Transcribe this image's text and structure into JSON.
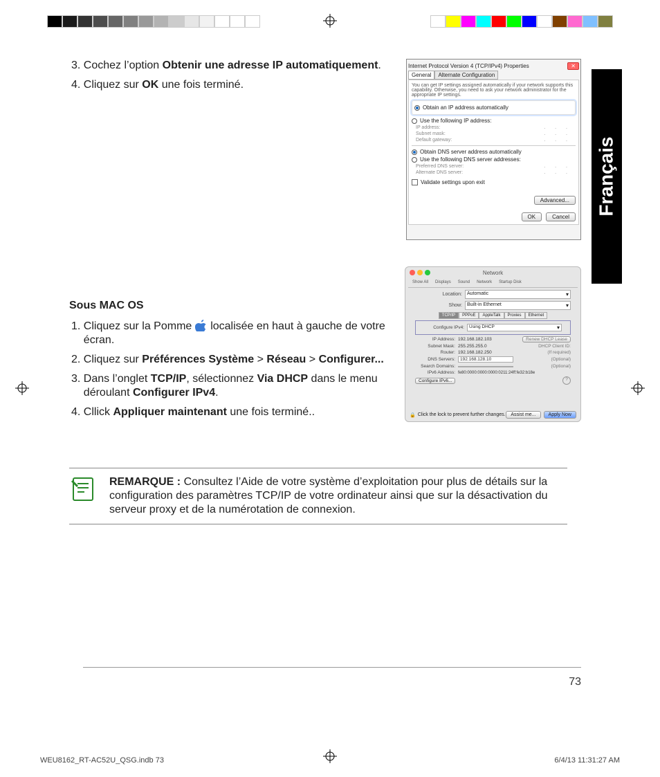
{
  "print": {
    "docname": "WEU8162_RT-AC52U_QSG.indb   73",
    "datetime": "6/4/13   11:31:27 AM",
    "colorbar_left": [
      "#000000",
      "#1a1a1a",
      "#333333",
      "#4d4d4d",
      "#666666",
      "#808080",
      "#999999",
      "#b3b3b3",
      "#cccccc",
      "#e6e6e6",
      "#f2f2f2",
      "#ffffff",
      "#ffffff",
      "#ffffff"
    ],
    "colorbar_right": [
      "#ffffff",
      "#ffff00",
      "#ff00ff",
      "#00ffff",
      "#ff0000",
      "#00ff00",
      "#0000ff",
      "#ffffff",
      "#804000",
      "#ff69d0",
      "#80c0ff",
      "#808040"
    ]
  },
  "lang_tab": "Français",
  "steps_a": [
    {
      "n": "3.",
      "pre": "Cochez l’option ",
      "bold": "Obtenir une adresse IP automatiquement",
      "post": "."
    },
    {
      "n": "4.",
      "pre": "Cliquez sur ",
      "bold": "OK",
      "post": " une fois terminé."
    }
  ],
  "macos_heading": "Sous MAC OS",
  "steps_b": [
    {
      "n": "1.",
      "parts": [
        "Cliquez sur la Pomme ",
        "ICON",
        " localisée en haut à gauche de votre écran."
      ]
    },
    {
      "n": "2.",
      "parts": [
        "Cliquez sur ",
        "B:Préférences Système",
        " > ",
        "B:Réseau",
        " > ",
        "B:Configurer..."
      ]
    },
    {
      "n": "3.",
      "parts": [
        "Dans l’onglet ",
        "B:TCP/IP",
        ", sélectionnez ",
        "B:Via DHCP",
        " dans le menu déroulant ",
        "B:Configurer IPv4",
        "."
      ]
    },
    {
      "n": "4.",
      "parts": [
        "Cllick ",
        "B:Appliquer maintenant",
        " une fois terminé.."
      ]
    }
  ],
  "note": {
    "label": "REMARQUE : ",
    "text": "Consultez l’Aide de votre système d’exploitation pour plus de détails sur la configuration des paramètres TCP/IP de votre ordinateur ainsi que sur la désactivation du serveur proxy et de la numérotation de connexion."
  },
  "page_number": "73",
  "win_dialog": {
    "title": "Internet Protocol Version 4 (TCP/IPv4) Properties",
    "tabs": [
      "General",
      "Alternate Configuration"
    ],
    "hint": "You can get IP settings assigned automatically if your network supports this capability. Otherwise, you need to ask your network administrator for the appropriate IP settings.",
    "r1": "Obtain an IP address automatically",
    "r2": "Use the following IP address:",
    "f_ip": "IP address:",
    "f_sm": "Subnet mask:",
    "f_gw": "Default gateway:",
    "r3": "Obtain DNS server address automatically",
    "r4": "Use the following DNS server addresses:",
    "f_pd": "Preferred DNS server:",
    "f_ad": "Alternate DNS server:",
    "chk": "Validate settings upon exit",
    "adv": "Advanced...",
    "ok": "OK",
    "cancel": "Cancel"
  },
  "mac_dialog": {
    "title": "Network",
    "toolbar": [
      "Show All",
      "Displays",
      "Sound",
      "Network",
      "Startup Disk"
    ],
    "location_lbl": "Location:",
    "location_val": "Automatic",
    "show_lbl": "Show:",
    "show_val": "Built-in Ethernet",
    "tabs": [
      "TCP/IP",
      "PPPoE",
      "AppleTalk",
      "Proxies",
      "Ethernet"
    ],
    "cfg_lbl": "Configure IPv4:",
    "cfg_val": "Using DHCP",
    "ip_lbl": "IP Address:",
    "ip_val": "192.168.182.103",
    "renew": "Renew DHCP Lease",
    "sm_lbl": "Subnet Mask:",
    "sm_val": "255.255.255.0",
    "dhcpid": "DHCP Client ID:",
    "ifreq": "(If required)",
    "rt_lbl": "Router:",
    "rt_val": "192.168.182.250",
    "dns_lbl": "DNS Servers:",
    "dns_val": "192.168.128.10",
    "opt": "(Optional)",
    "sd_lbl": "Search Domains:",
    "v6_lbl": "IPv6 Address:",
    "v6_val": "fe80:0000:0000:0000:0211:24ff:fe32:b18e",
    "cfg6": "Configure IPv6...",
    "lock": "Click the lock to prevent further changes.",
    "assist": "Assist me...",
    "apply": "Apply Now",
    "tl_cols": [
      "#ff5f56",
      "#ffbd2e",
      "#27c93f"
    ]
  }
}
